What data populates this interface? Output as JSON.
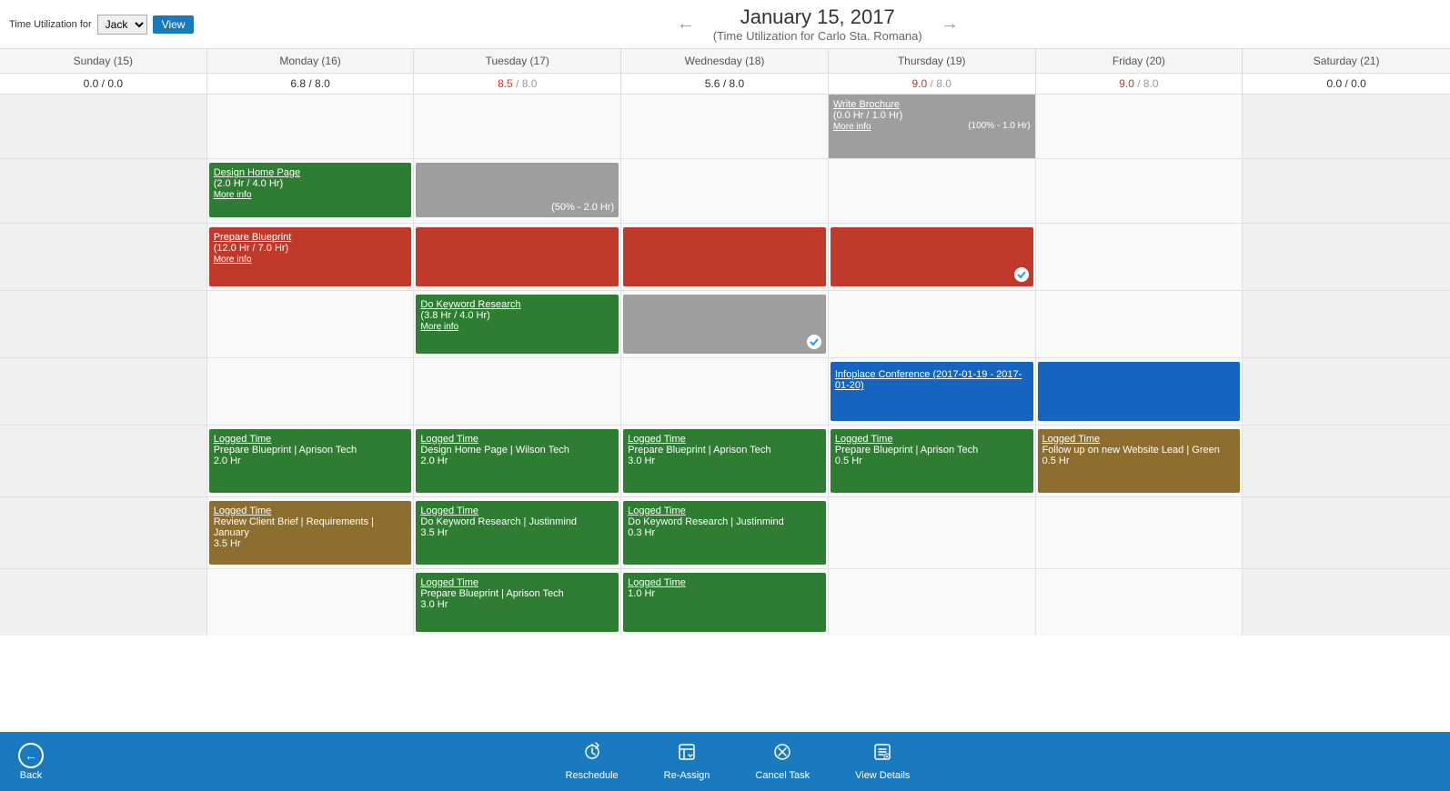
{
  "header": {
    "title": "January 15, 2017",
    "subtitle": "(Time Utilization for Carlo Sta. Romana)",
    "utilization_label": "Time Utilization for",
    "user": "Jack",
    "view_button": "View"
  },
  "days": [
    {
      "label": "Sunday (15)",
      "hours": "0.0 / 0.0",
      "over": false,
      "weekend": true
    },
    {
      "label": "Monday (16)",
      "hours": "6.8 / 8.0",
      "over": false,
      "weekend": false
    },
    {
      "label": "Tuesday (17)",
      "hours": "8.5 / 8.0",
      "over": true,
      "weekend": false
    },
    {
      "label": "Wednesday (18)",
      "hours": "5.6 / 8.0",
      "over": false,
      "weekend": false
    },
    {
      "label": "Thursday (19)",
      "hours": "9.0 / 8.0",
      "over": true,
      "weekend": false
    },
    {
      "label": "Friday (20)",
      "hours": "9.0 / 8.0",
      "over": true,
      "weekend": false
    },
    {
      "label": "Saturday (21)",
      "hours": "0.0 / 0.0",
      "over": false,
      "weekend": true
    }
  ],
  "toolbar": {
    "back_label": "Back",
    "reschedule_label": "Reschedule",
    "reassign_label": "Re-Assign",
    "cancel_task_label": "Cancel Task",
    "view_details_label": "View Details"
  }
}
